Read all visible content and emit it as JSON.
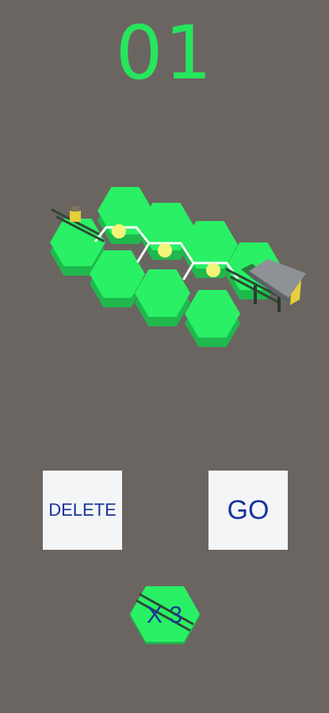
{
  "hud": {
    "level_number": "01"
  },
  "controls": {
    "delete_label": "DELETE",
    "go_label": "GO"
  },
  "inventory": {
    "count_label": "X 3"
  },
  "colors": {
    "background": "#6b6561",
    "tile_top": "#29f065",
    "tile_side": "#1fb84d",
    "counter": "#26e65c",
    "button_bg": "#f4f5f7",
    "button_text": "#17339a",
    "orb": "#f4f47a",
    "track_outline": "#ffffff",
    "rail": "#2d4a36",
    "building_roof": "#8e9296"
  }
}
